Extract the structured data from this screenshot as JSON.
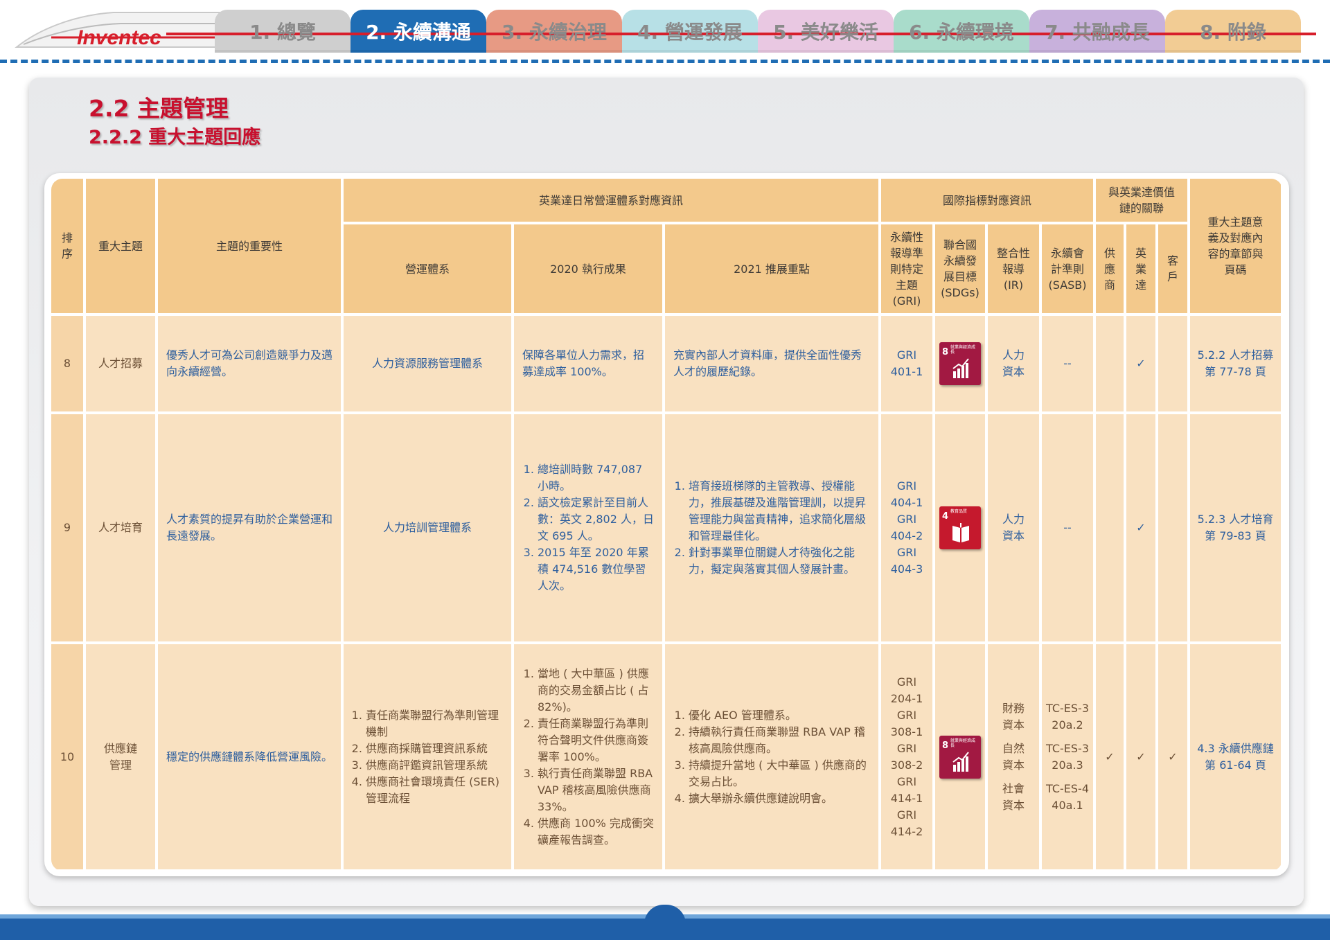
{
  "brand": {
    "logo": "Inventec",
    "accent": "#d71e2b"
  },
  "nav": {
    "tabs": [
      {
        "label": "1. 總覽",
        "color": "#cfcfcf",
        "active": false
      },
      {
        "label": "2. 永續溝通",
        "color": "#1f6db4",
        "active": true
      },
      {
        "label": "3. 永續治理",
        "color": "#e79a84",
        "active": false
      },
      {
        "label": "4. 營運發展",
        "color": "#b7e0e6",
        "active": false
      },
      {
        "label": "5. 美好樂活",
        "color": "#e9c8e2",
        "active": false
      },
      {
        "label": "6. 永續環境",
        "color": "#a9dccb",
        "active": false
      },
      {
        "label": "7. 共融成長",
        "color": "#c8b1dc",
        "active": false
      },
      {
        "label": "8. 附錄",
        "color": "#f2cc94",
        "active": false
      }
    ]
  },
  "page": {
    "title": "2.2 主題管理",
    "subtitle": "2.2.2 重大主題回應"
  },
  "table": {
    "headers": {
      "rank": "排序",
      "topic": "重大主題",
      "importance": "主題的重要性",
      "group_inventec": "英業達日常營運體系對應資訊",
      "group_intl": "國際指標對應資訊",
      "group_value": "與英業達價值鏈的關聯",
      "system": "營運體系",
      "result2020": "2020 執行成果",
      "focus2021": "2021 推展重點",
      "gri": "永續性報導準則特定主題(GRI)",
      "sdgs": "聯合國永續發展目標(SDGs)",
      "ir": "整合性報導(IR)",
      "sasb": "永續會計準則(SASB)",
      "supplier": "供應商",
      "inventec": "英業達",
      "customer": "客戶",
      "chapter": "重大主題意義及對應內容的章節與頁碼"
    },
    "rows": [
      {
        "rank": "8",
        "topic": "人才招募",
        "importance": "優秀人才可為公司創造競爭力及邁向永續經營。",
        "system": "人力資源服務管理體系",
        "result2020": [
          "保障各單位人力需求，招募達成率 100%。"
        ],
        "focus2021": [
          "充實內部人才資料庫，提供全面性優秀人才的履歷紀錄。"
        ],
        "gri": [
          "GRI",
          "401-1"
        ],
        "sdg": {
          "number": "8",
          "label": "就業與經濟成長",
          "icon": "growth-chart-icon"
        },
        "ir": [
          "人力",
          "資本"
        ],
        "sasb": [
          "--"
        ],
        "supplier": "",
        "inventec": "✓",
        "customer": "",
        "chapter": [
          "5.2.2 人才招募",
          "第 77-78 頁"
        ]
      },
      {
        "rank": "9",
        "topic": "人才培育",
        "importance": "人才素質的提昇有助於企業營運和長遠發展。",
        "system": "人力培訓管理體系",
        "result2020": [
          "總培訓時數 747,087 小時。",
          "語文檢定累計至目前人數：英文 2,802 人，日文 695 人。",
          "2015 年至 2020 年累積 474,516 數位學習人次。"
        ],
        "focus2021": [
          "培育接班梯隊的主管教導、授權能力，推展基礎及進階管理訓，以提昇管理能力與當責精神，追求簡化層級和管理最佳化。",
          "針對事業單位關鍵人才待強化之能力，擬定與落實其個人發展計畫。"
        ],
        "gri": [
          "GRI",
          "404-1",
          "GRI",
          "404-2",
          "GRI",
          "404-3"
        ],
        "sdg": {
          "number": "4",
          "label": "教育品質",
          "icon": "book-icon"
        },
        "ir": [
          "人力",
          "資本"
        ],
        "sasb": [
          "--"
        ],
        "supplier": "",
        "inventec": "✓",
        "customer": "",
        "chapter": [
          "5.2.3 人才培育",
          "第 79-83 頁"
        ]
      },
      {
        "rank": "10",
        "topic": "供應鏈管理",
        "importance": "穩定的供應鏈體系降低營運風險。",
        "system_list": [
          "責任商業聯盟行為準則管理機制",
          "供應商採購管理資訊系統",
          "供應商評鑑資訊管理系統",
          "供應商社會環境責任 (SER) 管理流程"
        ],
        "result2020": [
          "當地 ( 大中華區 ) 供應商的交易金額占比 ( 占 82%)。",
          "責任商業聯盟行為準則符合聲明文件供應商簽署率 100%。",
          "執行責任商業聯盟 RBA VAP 稽核高風險供應商 33%。",
          "供應商 100% 完成衝突礦產報告調查。"
        ],
        "focus2021": [
          "優化 AEO 管理體系。",
          "持續執行責任商業聯盟 RBA VAP 稽核高風險供應商。",
          "持續提升當地 ( 大中華區 ) 供應商的交易占比。",
          "擴大舉辦永續供應鏈說明會。"
        ],
        "gri": [
          "GRI",
          "204-1",
          "GRI",
          "308-1",
          "GRI",
          "308-2",
          "GRI",
          "414-1",
          "GRI",
          "414-2"
        ],
        "sdg": {
          "number": "8",
          "label": "就業與經濟成長",
          "icon": "growth-chart-icon"
        },
        "ir_groups": [
          [
            "財務",
            "資本"
          ],
          [
            "自然",
            "資本"
          ],
          [
            "社會",
            "資本"
          ]
        ],
        "sasb": [
          "TC-ES-320a.2",
          "TC-ES-320a.3",
          "TC-ES-440a.1"
        ],
        "supplier": "✓",
        "inventec": "✓",
        "customer": "✓",
        "chapter": [
          "4.3 永續供應鏈",
          "第 61-64 頁"
        ]
      }
    ]
  }
}
